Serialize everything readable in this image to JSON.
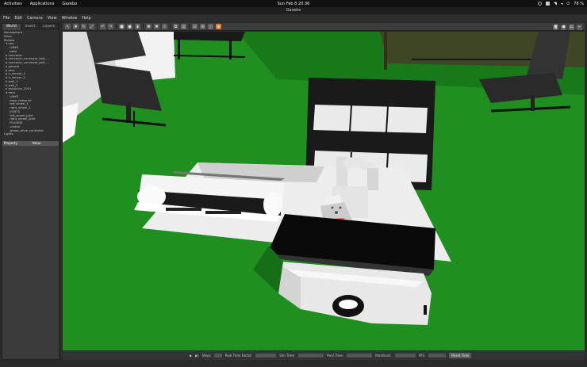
{
  "topbar": {
    "activities": "Activities",
    "applications": "Applications",
    "app_name": "Gazebo",
    "clock": "Sun Feb 8  20:36",
    "battery": "78 %"
  },
  "window": {
    "title": "Gazebo"
  },
  "menu": {
    "items": [
      "File",
      "Edit",
      "Camera",
      "View",
      "Window",
      "Help"
    ]
  },
  "left_panel": {
    "tabs": [
      "World",
      "Insert",
      "Layers"
    ],
    "tree": [
      "Atmosphere",
      "Wind",
      "Models",
      "  ▾ ceo",
      "      LINKS",
      "      base",
      "  ▸ conveyor",
      "  ▸ conveyor_conveyor_belt_...",
      "  ▸ conveyor_conveyor_belt_...",
      "  ▸ ground",
      "  ▸ rack",
      "  ▸ ir_sensor_1",
      "  ▸ ir_sensor_2",
      "  ▸ wall_1",
      "  ▸ wall_2",
      "  ▸ repulsion_2001",
      "  ▾ ebot",
      "      LINKS",
      "      base_footprint",
      "      left_wheel_1",
      "      right_wheel_1",
      "      JOINTS",
      "      left_wheel_joint",
      "      right_wheel_joint",
      "      PLUGINS",
      "      control",
      "      wheel_drive_controller",
      "Lights"
    ],
    "property_col": "Property",
    "value_col": "Value"
  },
  "bottom": {
    "steps": "Steps",
    "real_time_factor": "Real Time Factor:",
    "sim_time": "Sim Time:",
    "real_time": "Real Time:",
    "iterations": "Iterations:",
    "fps": "FPS:",
    "reset": "Reset Time"
  },
  "colors": {
    "ground": "#1f8f1f",
    "table_white": "#f2f2f2",
    "box_red": "#dd1111"
  }
}
